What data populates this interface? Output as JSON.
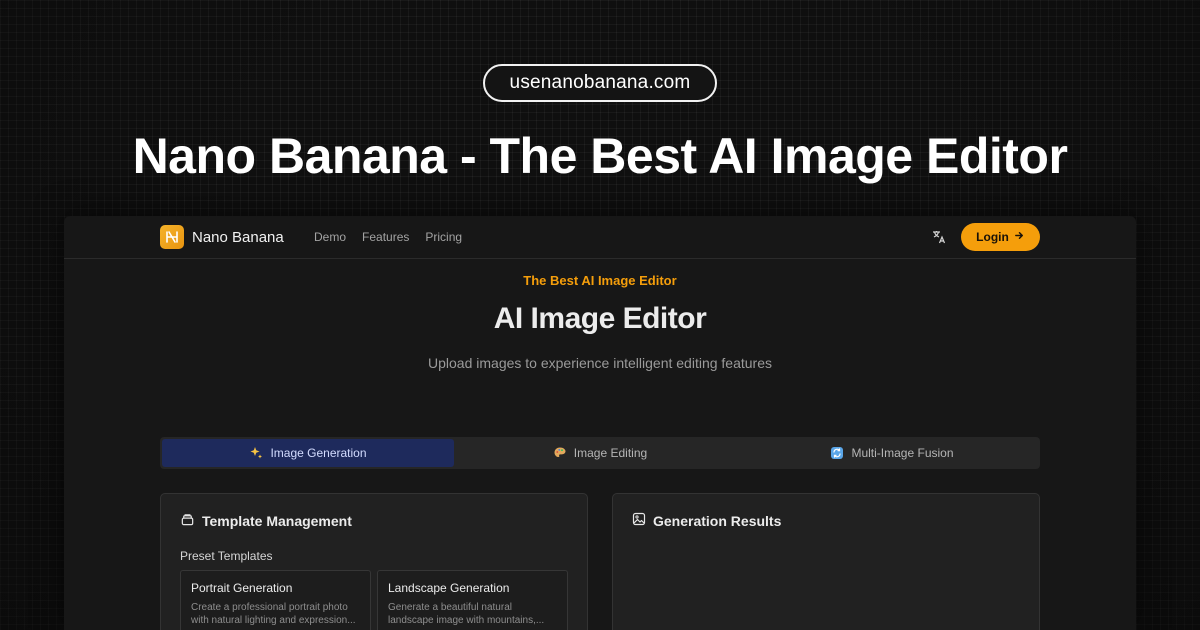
{
  "banner": {
    "domain": "usenanobanana.com",
    "headline": "Nano Banana - The Best AI Image Editor"
  },
  "app": {
    "brand": {
      "name": "Nano Banana",
      "logo_icon": "banana-logo-icon"
    },
    "nav_links": [
      "Demo",
      "Features",
      "Pricing"
    ],
    "login_label": "Login",
    "accent_color": "#f59e0b",
    "hero": {
      "eyebrow": "The Best AI Image Editor",
      "title": "AI Image Editor",
      "subtitle": "Upload images to experience intelligent editing features"
    },
    "tabs": [
      {
        "label": "Image Generation",
        "icon": "sparkles-icon",
        "active": true
      },
      {
        "label": "Image Editing",
        "icon": "palette-icon",
        "active": false
      },
      {
        "label": "Multi-Image Fusion",
        "icon": "fusion-icon",
        "active": false
      }
    ],
    "template_panel": {
      "title": "Template Management",
      "preset_label": "Preset Templates",
      "templates": [
        {
          "title": "Portrait Generation",
          "desc_line1": "Create a professional portrait photo",
          "desc_line2": "with natural lighting and expression..."
        },
        {
          "title": "Landscape Generation",
          "desc_line1": "Generate a beautiful natural",
          "desc_line2": "landscape image with mountains,..."
        }
      ]
    },
    "results_panel": {
      "title": "Generation Results"
    }
  }
}
